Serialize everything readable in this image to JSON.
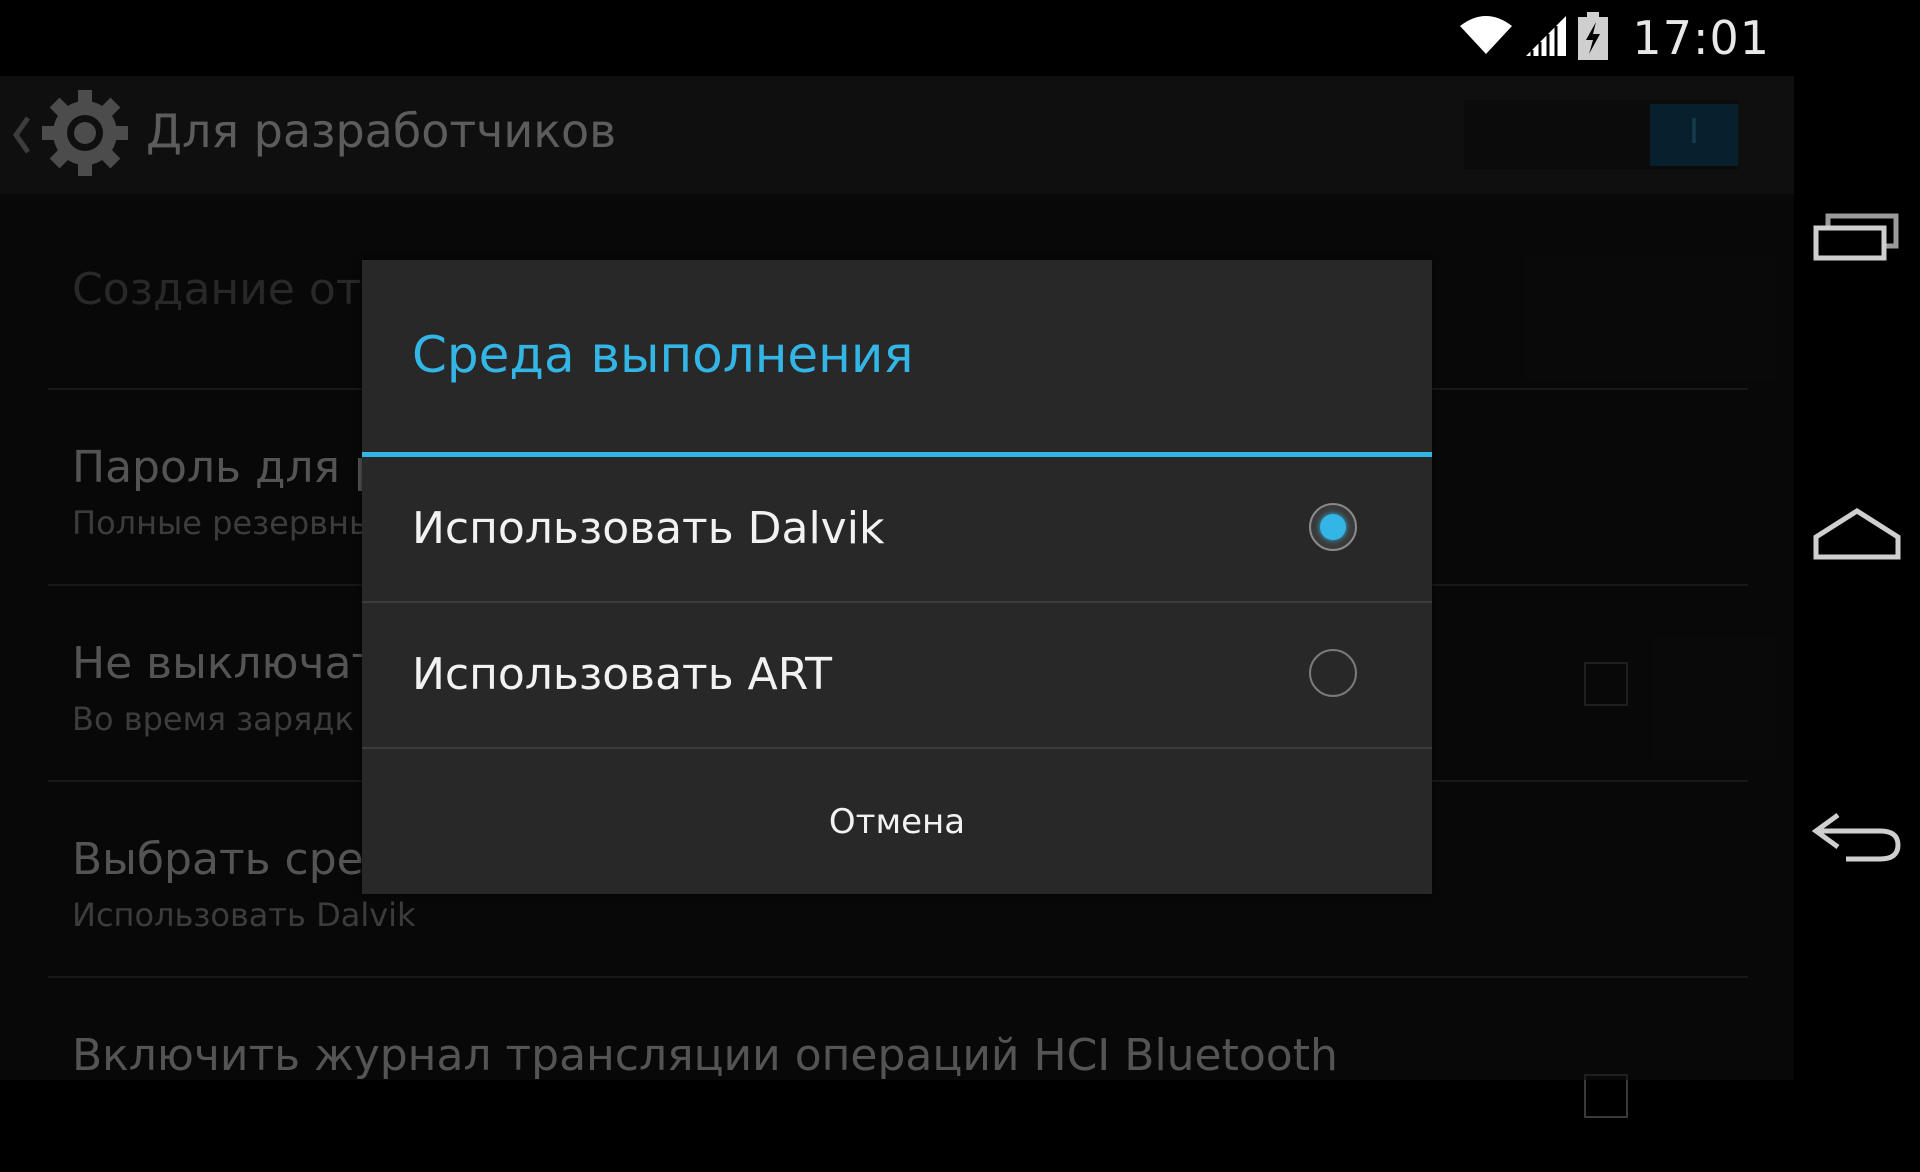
{
  "status_bar": {
    "time": "17:01",
    "icons": [
      "wifi-icon",
      "cell-signal-icon",
      "battery-charging-icon"
    ]
  },
  "action_bar": {
    "title": "Для разработчиков",
    "toggle_label": "I",
    "icons": [
      "back-chevron-icon",
      "settings-gear-icon"
    ]
  },
  "settings_list": [
    {
      "title": "Создание отч",
      "subtitle": ""
    },
    {
      "title": "Пароль для р",
      "subtitle": "Полные резервны"
    },
    {
      "title": "Не выключат",
      "subtitle": "Во время зарядк"
    },
    {
      "title": "Выбрать сред",
      "subtitle": "Использовать Dalvik"
    },
    {
      "title": "Включить журнал трансляции операций HCI Bluetooth",
      "subtitle": ""
    }
  ],
  "dialog": {
    "title": "Среда выполнения",
    "options": [
      {
        "label": "Использовать Dalvik",
        "selected": true
      },
      {
        "label": "Использовать ART",
        "selected": false
      }
    ],
    "cancel_label": "Отмена"
  },
  "navigation_bar": {
    "icons": [
      "recent-apps-icon",
      "home-icon",
      "back-icon"
    ]
  },
  "colors": {
    "accent": "#33b5e5",
    "dialog_bg": "#282828",
    "app_bg": "#101010"
  }
}
